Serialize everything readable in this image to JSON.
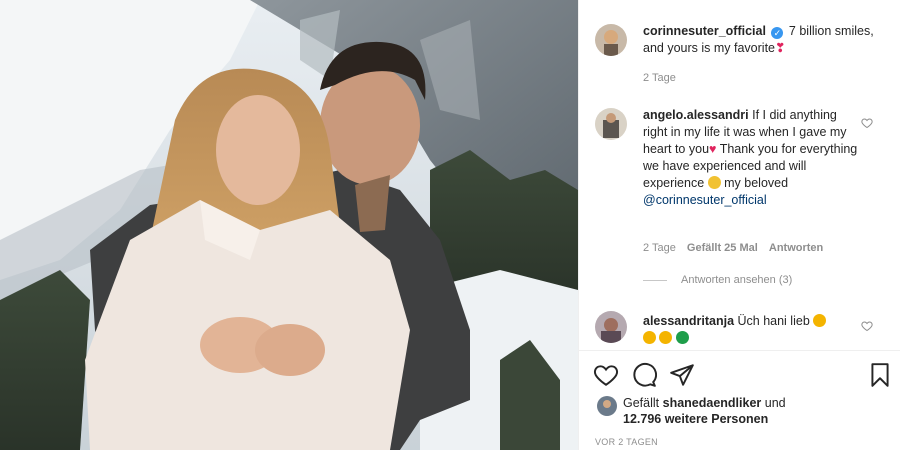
{
  "post": {
    "author": "corinnesuter_official",
    "caption_text": "7 billion smiles, and yours is my favorite",
    "caption_emoji": "❣",
    "caption_age": "2 Tage"
  },
  "comments": [
    {
      "user": "angelo.alessandri",
      "text": "If I did anything right in my life it was when I gave my heart to you",
      "emoji_heart": "♥",
      "text2": "Thank you for everything we have experienced and will experience",
      "text3": "my beloved",
      "mention": "@corinnesuter_official",
      "age": "2 Tage",
      "likes": "Gefällt 25 Mal",
      "reply_label": "Antworten",
      "view_replies": "Antworten ansehen (3)"
    },
    {
      "user": "alessandritanja",
      "text": "Üch hani lieb"
    }
  ],
  "footer": {
    "liked_prefix": "Gefällt",
    "liked_user": "shanedaendliker",
    "liked_and": "und",
    "liked_others": "12.796 weitere Personen",
    "timestamp": "VOR 2 TAGEN"
  },
  "colors": {
    "verified": "#3897f0",
    "heart": "#e0245e",
    "meta": "#8e8e8e",
    "mention": "#00376b"
  },
  "icons": [
    "heart-icon",
    "comment-icon",
    "share-icon",
    "bookmark-icon",
    "verified-icon"
  ]
}
